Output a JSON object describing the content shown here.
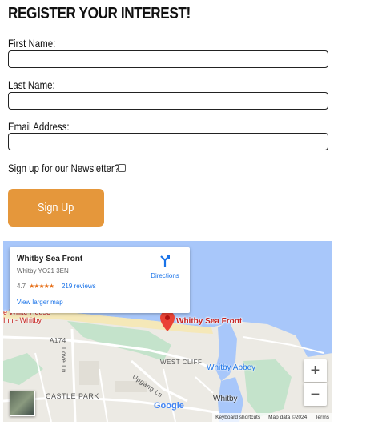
{
  "form": {
    "title": "REGISTER YOUR INTEREST!",
    "first_name_label": "First Name:",
    "last_name_label": "Last Name:",
    "email_label": "Email Address:",
    "first_name_value": "",
    "last_name_value": "",
    "email_value": "",
    "newsletter_label": "Sign up for our Newsletter?",
    "newsletter_checked": false,
    "submit_label": "Sign Up",
    "button_color": "#e5973b"
  },
  "map": {
    "place_name": "Whitby Sea Front",
    "address": "Whitby YO21 3EN",
    "rating": "4.7",
    "stars": "★★★★★",
    "reviews": "219 reviews",
    "larger_map": "View larger map",
    "directions": "Directions",
    "pin_label": "Whitby Sea Front",
    "poi_whitehouse_line1": "e White House",
    "poi_whitehouse_line2": "Inn - Whitby",
    "poi_abbey": "Whitby Abbey",
    "road_a174": "A174",
    "road_love_ln": "Love Ln",
    "road_upgang_ln": "Upgang Ln",
    "area_west_cliff": "WEST CLIFF",
    "area_castle_park": "CASTLE PARK",
    "town": "Whitby",
    "zoom_in": "+",
    "zoom_out": "−",
    "google": "Google",
    "keyboard_shortcuts": "Keyboard shortcuts",
    "map_data": "Map data ©2024",
    "terms": "Terms",
    "water_color": "#a8c7fa",
    "land_color": "#eceae4",
    "beach_color": "#f5e8b8",
    "green_color": "#c4e3cb"
  }
}
